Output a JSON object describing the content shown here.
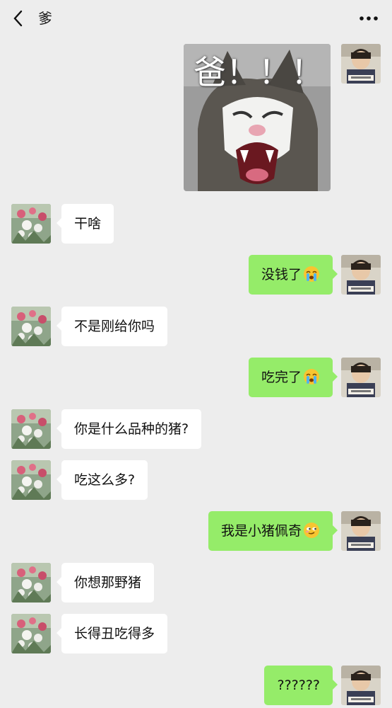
{
  "header": {
    "title": "爹",
    "back_icon": "chevron-left-icon",
    "more_icon": "more-dots-icon"
  },
  "sticker": {
    "caption": "爸！！！",
    "image": "screaming-cat-sticker"
  },
  "messages": [
    {
      "sender": "dad",
      "text": "干啥"
    },
    {
      "sender": "me",
      "text": "没钱了",
      "emoji": "crying-face-emoji"
    },
    {
      "sender": "dad",
      "text": "不是刚给你吗"
    },
    {
      "sender": "me",
      "text": "吃完了",
      "emoji": "crying-face-emoji"
    },
    {
      "sender": "dad",
      "text": "你是什么品种的猪?"
    },
    {
      "sender": "dad",
      "text": "吃这么多?"
    },
    {
      "sender": "me",
      "text": "我是小猪佩奇",
      "emoji": "smirk-face-emoji"
    },
    {
      "sender": "dad",
      "text": "你想那野猪"
    },
    {
      "sender": "dad",
      "text": "长得丑吃得多"
    },
    {
      "sender": "me",
      "text": "??????"
    }
  ],
  "avatars": {
    "me": "child-photo-avatar",
    "dad": "flowers-photo-avatar"
  },
  "colors": {
    "background": "#ededed",
    "outgoing_bubble": "#95ec69",
    "incoming_bubble": "#ffffff"
  }
}
